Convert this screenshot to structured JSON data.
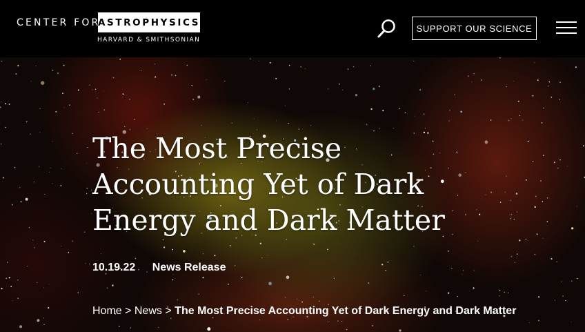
{
  "header": {
    "logo_prefix": "CENTER FOR",
    "logo_main": "ASTROPHYSICS",
    "logo_sub": "HARVARD & SMITHSONIAN",
    "search_icon": "search-icon",
    "support_label": "SUPPORT OUR SCIENCE",
    "menu_icon": "hamburger-menu-icon"
  },
  "hero": {
    "title": "The Most Precise Accounting Yet of Dark Energy and Dark Matter",
    "date": "10.19.22",
    "category": "News Release",
    "breadcrumb": {
      "home": "Home",
      "sep1": " > ",
      "news": "News",
      "sep2": " > ",
      "current": "The Most Precise Accounting Yet of Dark Energy and Dark Matter"
    }
  },
  "colors": {
    "header_bg": "#000000",
    "text": "#ffffff"
  }
}
